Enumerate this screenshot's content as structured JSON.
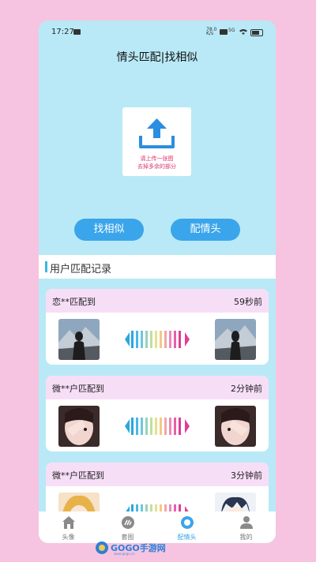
{
  "status_bar": {
    "time": "17:27",
    "network_a": "78.0\nK/s",
    "network_b": "5G"
  },
  "page_title": "情头匹配|找相似",
  "upload": {
    "line1": "请上传一张图",
    "line2": "去掉多余的部分"
  },
  "buttons": {
    "find_similar": "找相似",
    "match_avatar": "配情头"
  },
  "records": {
    "header": "用户匹配记录",
    "items": [
      {
        "who": "恋**匹配到",
        "when": "59秒前"
      },
      {
        "who": "微**户匹配到",
        "when": "2分钟前"
      },
      {
        "who": "微**户匹配到",
        "when": "3分钟前"
      }
    ]
  },
  "tabbar": {
    "items": [
      {
        "label": "头像",
        "icon": "home-icon"
      },
      {
        "label": "套图",
        "icon": "gallery-icon"
      },
      {
        "label": "配情头",
        "icon": "match-icon"
      },
      {
        "label": "我的",
        "icon": "profile-icon"
      }
    ],
    "active_index": 2
  },
  "watermark": {
    "text": "GOGO手游网",
    "sub": "www.gogo.cn"
  },
  "colors": {
    "page_bg": "#f6c4e0",
    "panel_bg": "#b9e9f6",
    "accent": "#3aa5ea",
    "card_header": "#f7def7",
    "upload_text": "#e0306a"
  }
}
